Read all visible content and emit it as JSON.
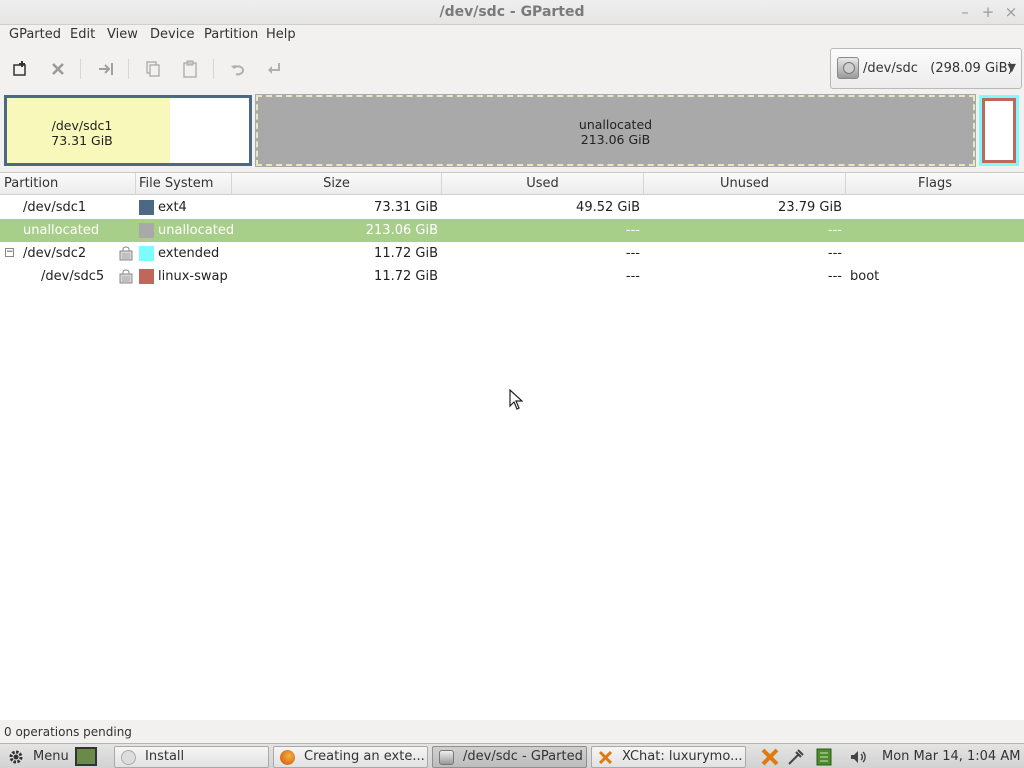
{
  "window": {
    "title": "/dev/sdc - GParted"
  },
  "menu": [
    {
      "label": "GParted"
    },
    {
      "label": "Edit"
    },
    {
      "label": "View"
    },
    {
      "label": "Device"
    },
    {
      "label": "Partition"
    },
    {
      "label": "Help"
    }
  ],
  "device_selector": {
    "label": "/dev/sdc   (298.09 GiB)"
  },
  "disk_map": {
    "sdc1": {
      "name": "/dev/sdc1",
      "size": "73.31 GiB",
      "used_fraction": 0.675
    },
    "unalloc": {
      "name": "unallocated",
      "size": "213.06 GiB"
    }
  },
  "table": {
    "headers": [
      "Partition",
      "File System",
      "Size",
      "Used",
      "Unused",
      "Flags"
    ],
    "rows": [
      {
        "partition": "/dev/sdc1",
        "fs": "ext4",
        "fs_color": "#4b6983",
        "size": "73.31 GiB",
        "used": "49.52 GiB",
        "unused": "23.79 GiB",
        "flags": ""
      },
      {
        "partition": "unallocated",
        "fs": "unallocated",
        "fs_color": "#a9a9a9",
        "size": "213.06 GiB",
        "used": "---",
        "unused": "---",
        "flags": ""
      },
      {
        "partition": "/dev/sdc2",
        "fs": "extended",
        "fs_color": "#7dfcfe",
        "size": "11.72 GiB",
        "used": "---",
        "unused": "---",
        "flags": ""
      },
      {
        "partition": "/dev/sdc5",
        "fs": "linux-swap",
        "fs_color": "#c1665a",
        "size": "11.72 GiB",
        "used": "---",
        "unused": "---",
        "flags": "boot"
      }
    ]
  },
  "status": {
    "text": "0 operations pending"
  },
  "taskbar": {
    "menu_label": "Menu",
    "tasks": [
      {
        "label": "Install"
      },
      {
        "label": "Creating an exte..."
      },
      {
        "label": "/dev/sdc - GParted"
      },
      {
        "label": "XChat: luxurymo..."
      }
    ],
    "clock": "Mon Mar 14,  1:04 AM"
  },
  "colors": {
    "selection": "#a8cf8a",
    "ext4": "#4b6983",
    "unallocated": "#a9a9a9",
    "extended": "#7dfcfe",
    "linux_swap": "#c1665a",
    "used_space": "#f8f8ba"
  }
}
